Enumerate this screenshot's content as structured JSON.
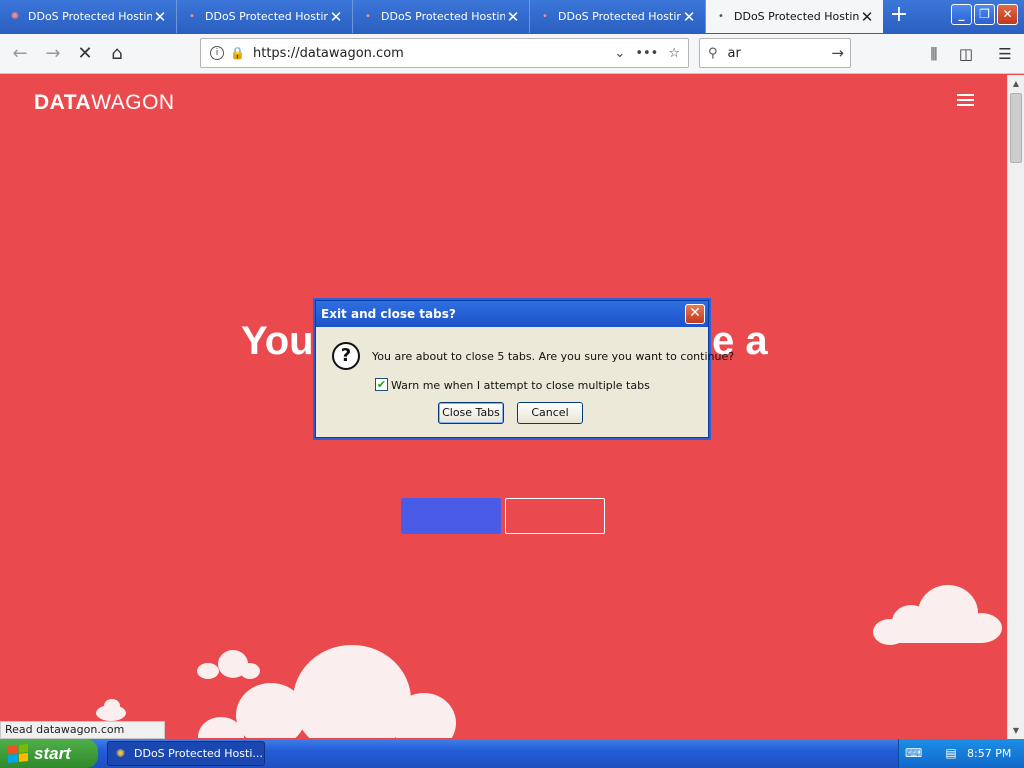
{
  "browser": {
    "tabs": [
      {
        "title": "DDoS Protected Hosting",
        "active": false
      },
      {
        "title": "DDoS Protected Hosting",
        "active": false
      },
      {
        "title": "DDoS Protected Hosting",
        "active": false
      },
      {
        "title": "DDoS Protected Hosting",
        "active": false
      },
      {
        "title": "DDoS Protected Hosting",
        "active": true
      }
    ],
    "url": "https://datawagon.com",
    "search_text": "ar",
    "status_text": "Read datawagon.com"
  },
  "page": {
    "logo_bold": "DATA",
    "logo_light": "WAGON",
    "hero_left": "You",
    "hero_right": "e a"
  },
  "dialog": {
    "title": "Exit and close tabs?",
    "message": "You are about to close 5 tabs. Are you sure you want to continue?",
    "checkbox_label": "Warn me when I attempt to close multiple tabs",
    "checkbox_checked": true,
    "confirm_label": "Close Tabs",
    "cancel_label": "Cancel"
  },
  "taskbar": {
    "start_label": "start",
    "task_title": "DDoS Protected Hosti...",
    "clock": "8:57 PM"
  },
  "colors": {
    "page_background": "#ea4a4d",
    "hero_primary_button": "#4a5be8",
    "taskbar": "#245cd6",
    "start_button": "#3a9b34"
  }
}
